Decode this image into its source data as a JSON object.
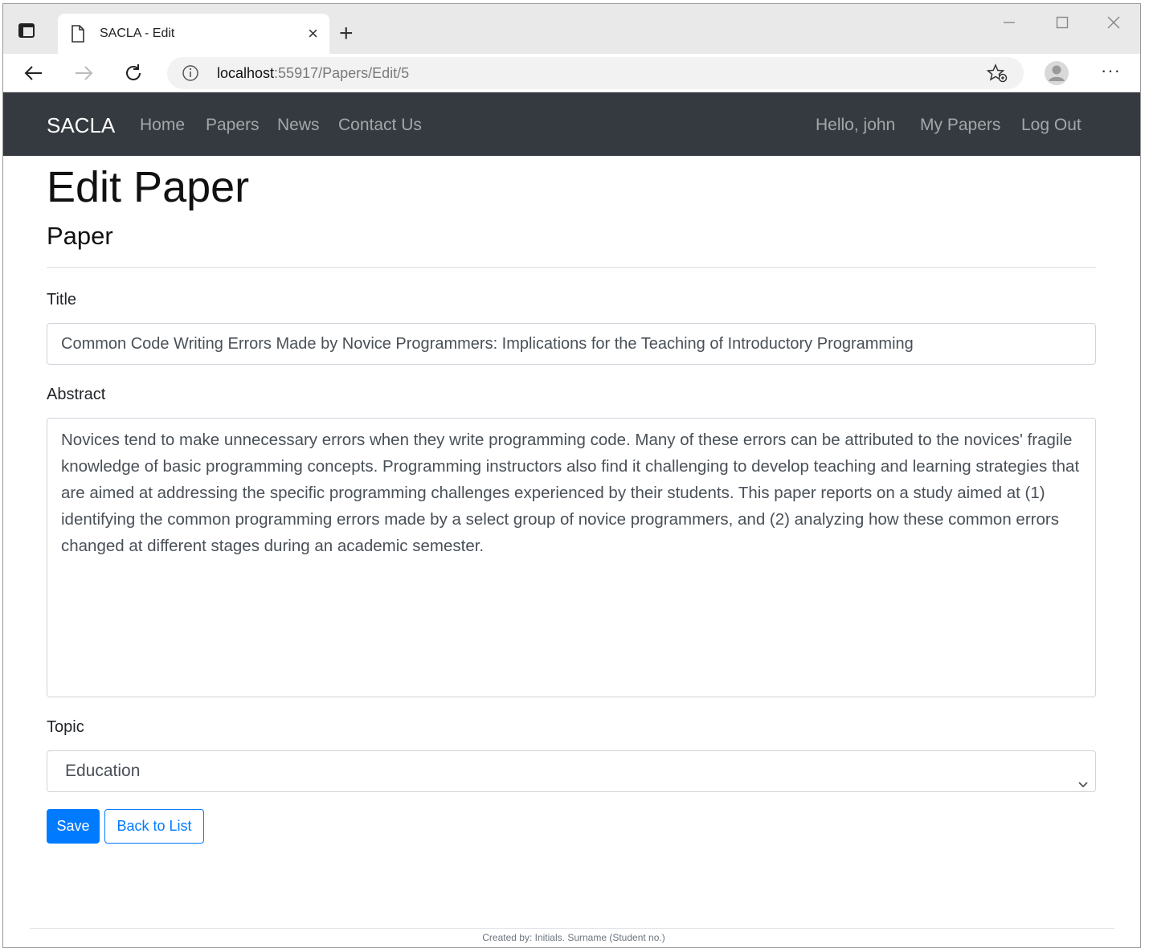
{
  "browser": {
    "tab_title": "SACLA - Edit",
    "tab_close": "×",
    "new_tab": "+",
    "url_host": "localhost",
    "url_path": ":55917/Papers/Edit/5",
    "more": "···",
    "icons": [
      "tab-actions-icon",
      "page-icon",
      "back-arrow-icon",
      "forward-arrow-icon",
      "reload-icon",
      "info-icon",
      "favorites-icon",
      "profile-icon",
      "more-icon",
      "minimize-icon",
      "maximize-icon",
      "close-window-icon"
    ]
  },
  "navbar": {
    "brand": "SACLA",
    "links": [
      "Home",
      "Papers",
      "News",
      "Contact Us"
    ],
    "greeting": "Hello, john",
    "my_papers": "My Papers",
    "logout": "Log Out"
  },
  "page": {
    "title": "Edit Paper",
    "subtitle": "Paper"
  },
  "form": {
    "title_label": "Title",
    "title_value": "Common Code Writing Errors Made by Novice Programmers: Implications for the Teaching of Introductory Programming",
    "abstract_label": "Abstract",
    "abstract_value": "Novices tend to make unnecessary errors when they write programming code. Many of these errors can be attributed to the novices' fragile knowledge of basic programming concepts. Programming instructors also find it challenging to develop teaching and learning strategies that are aimed at addressing the specific programming challenges experienced by their students. This paper reports on a study aimed at (1) identifying the common programming errors made by a select group of novice programmers, and (2) analyzing how these common errors changed at different stages during an academic semester.",
    "topic_label": "Topic",
    "topic_value": "Education",
    "save_label": "Save",
    "back_label": "Back to List"
  },
  "footer": {
    "text": "Created by: Initials. Surname (Student no.)"
  },
  "colors": {
    "navbar_bg": "#343a40",
    "primary": "#007bff"
  }
}
